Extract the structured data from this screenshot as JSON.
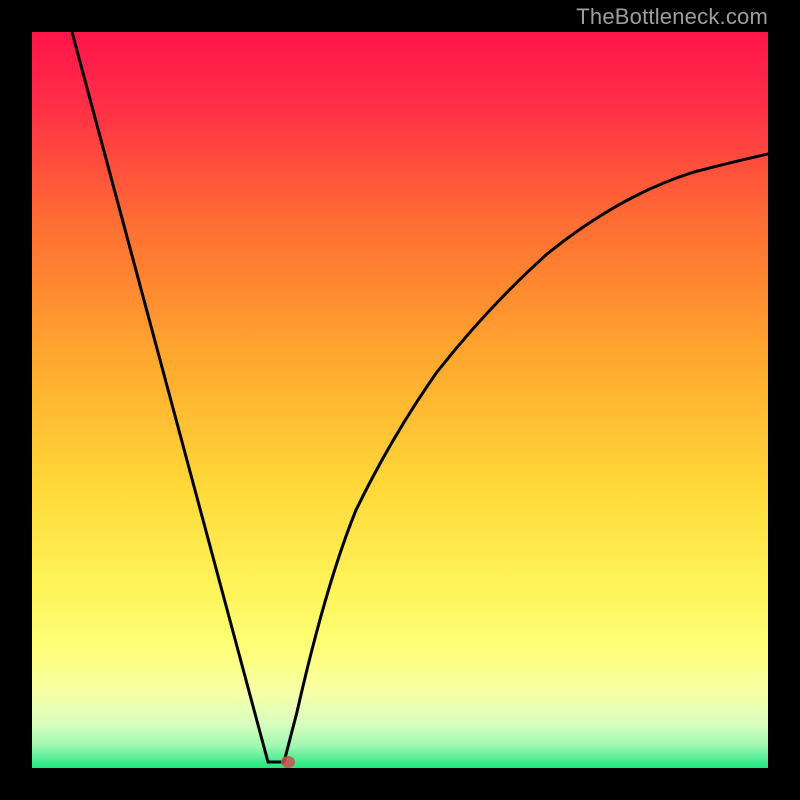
{
  "watermark": "TheBottleneck.com",
  "chart_data": {
    "type": "line",
    "title": "",
    "xlabel": "",
    "ylabel": "",
    "xlim": [
      0,
      1
    ],
    "ylim": [
      0,
      1
    ],
    "gradient_colors": {
      "top": "#ff1b4b",
      "mid1": "#ff7a2a",
      "mid2": "#ffd640",
      "mid3": "#ffff66",
      "low": "#f3ffb0",
      "bottom": "#1ee882"
    },
    "curve": {
      "left_branch": [
        {
          "x": 0.055,
          "y": 1.0
        },
        {
          "x": 0.332,
          "y": 0.0
        }
      ],
      "vertex": {
        "x": 0.332,
        "y": 0.0
      },
      "right_branch": [
        {
          "x": 0.332,
          "y": 0.0
        },
        {
          "x": 0.365,
          "y": 0.13
        },
        {
          "x": 0.4,
          "y": 0.245
        },
        {
          "x": 0.44,
          "y": 0.35
        },
        {
          "x": 0.49,
          "y": 0.45
        },
        {
          "x": 0.55,
          "y": 0.545
        },
        {
          "x": 0.62,
          "y": 0.625
        },
        {
          "x": 0.7,
          "y": 0.695
        },
        {
          "x": 0.8,
          "y": 0.755
        },
        {
          "x": 0.9,
          "y": 0.795
        },
        {
          "x": 1.0,
          "y": 0.825
        }
      ]
    },
    "marker": {
      "x": 0.345,
      "y": 0.005,
      "color": "#cc4f4f"
    }
  }
}
